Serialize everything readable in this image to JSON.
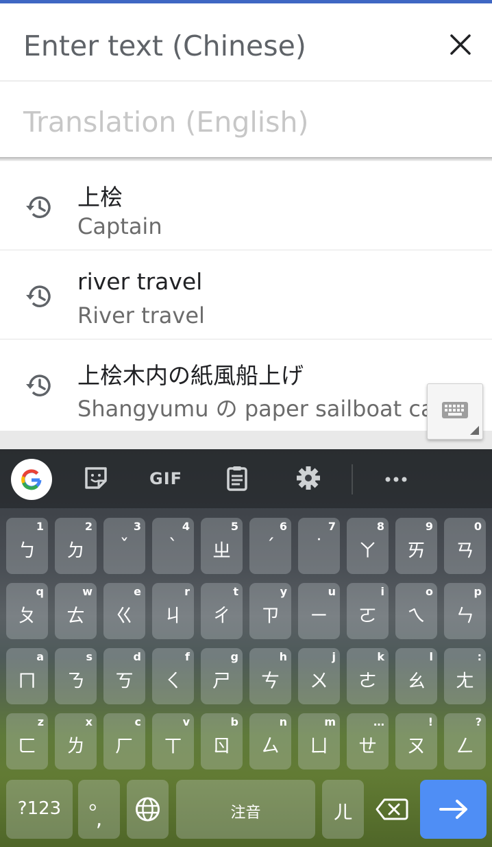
{
  "input": {
    "placeholder": "Enter text (Chinese)",
    "close_icon": "close-icon"
  },
  "translation": {
    "placeholder": "Translation (English)"
  },
  "history": [
    {
      "source": "上桧",
      "translation": "Captain"
    },
    {
      "source": "river travel",
      "translation": "River travel"
    },
    {
      "source": "上桧木内の紙風船上げ",
      "translation": "Shangyumu の paper sailboat ca"
    }
  ],
  "keyboard_toolbar": {
    "gif_label": "GIF"
  },
  "keys": {
    "row1": [
      {
        "main": "ㄅ",
        "hint": "1"
      },
      {
        "main": "ㄉ",
        "hint": "2"
      },
      {
        "main": "ˇ",
        "hint": "3"
      },
      {
        "main": "ˋ",
        "hint": "4"
      },
      {
        "main": "ㄓ",
        "hint": "5"
      },
      {
        "main": "ˊ",
        "hint": "6"
      },
      {
        "main": "˙",
        "hint": "7"
      },
      {
        "main": "ㄚ",
        "hint": "8"
      },
      {
        "main": "ㄞ",
        "hint": "9"
      },
      {
        "main": "ㄢ",
        "hint": "0"
      }
    ],
    "row2": [
      {
        "main": "ㄆ",
        "hint": "q"
      },
      {
        "main": "ㄊ",
        "hint": "w"
      },
      {
        "main": "ㄍ",
        "hint": "e"
      },
      {
        "main": "ㄐ",
        "hint": "r"
      },
      {
        "main": "ㄔ",
        "hint": "t"
      },
      {
        "main": "ㄗ",
        "hint": "y"
      },
      {
        "main": "ㄧ",
        "hint": "u"
      },
      {
        "main": "ㄛ",
        "hint": "i"
      },
      {
        "main": "ㄟ",
        "hint": "o"
      },
      {
        "main": "ㄣ",
        "hint": "p"
      }
    ],
    "row3": [
      {
        "main": "ㄇ",
        "hint": "a"
      },
      {
        "main": "ㄋ",
        "hint": "s"
      },
      {
        "main": "ㄎ",
        "hint": "d"
      },
      {
        "main": "ㄑ",
        "hint": "f"
      },
      {
        "main": "ㄕ",
        "hint": "g"
      },
      {
        "main": "ㄘ",
        "hint": "h"
      },
      {
        "main": "ㄨ",
        "hint": "j"
      },
      {
        "main": "ㄜ",
        "hint": "k"
      },
      {
        "main": "ㄠ",
        "hint": "l"
      },
      {
        "main": "ㄤ",
        "hint": ":"
      }
    ],
    "row4": [
      {
        "main": "ㄈ",
        "hint": "z"
      },
      {
        "main": "ㄌ",
        "hint": "x"
      },
      {
        "main": "ㄏ",
        "hint": "c"
      },
      {
        "main": "ㄒ",
        "hint": "v"
      },
      {
        "main": "ㄖ",
        "hint": "b"
      },
      {
        "main": "ㄙ",
        "hint": "n"
      },
      {
        "main": "ㄩ",
        "hint": "m"
      },
      {
        "main": "ㄝ",
        "hint": "…"
      },
      {
        "main": "ㄡ",
        "hint": "!"
      },
      {
        "main": "ㄥ",
        "hint": "?"
      }
    ]
  },
  "bottom_row": {
    "symbols_label": "?123",
    "punct_main": "。",
    "punct_sub": ",",
    "space_label": "注音",
    "er_key": "ㄦ"
  },
  "colors": {
    "accent": "#3f67c3",
    "enter": "#4f8ef5"
  }
}
